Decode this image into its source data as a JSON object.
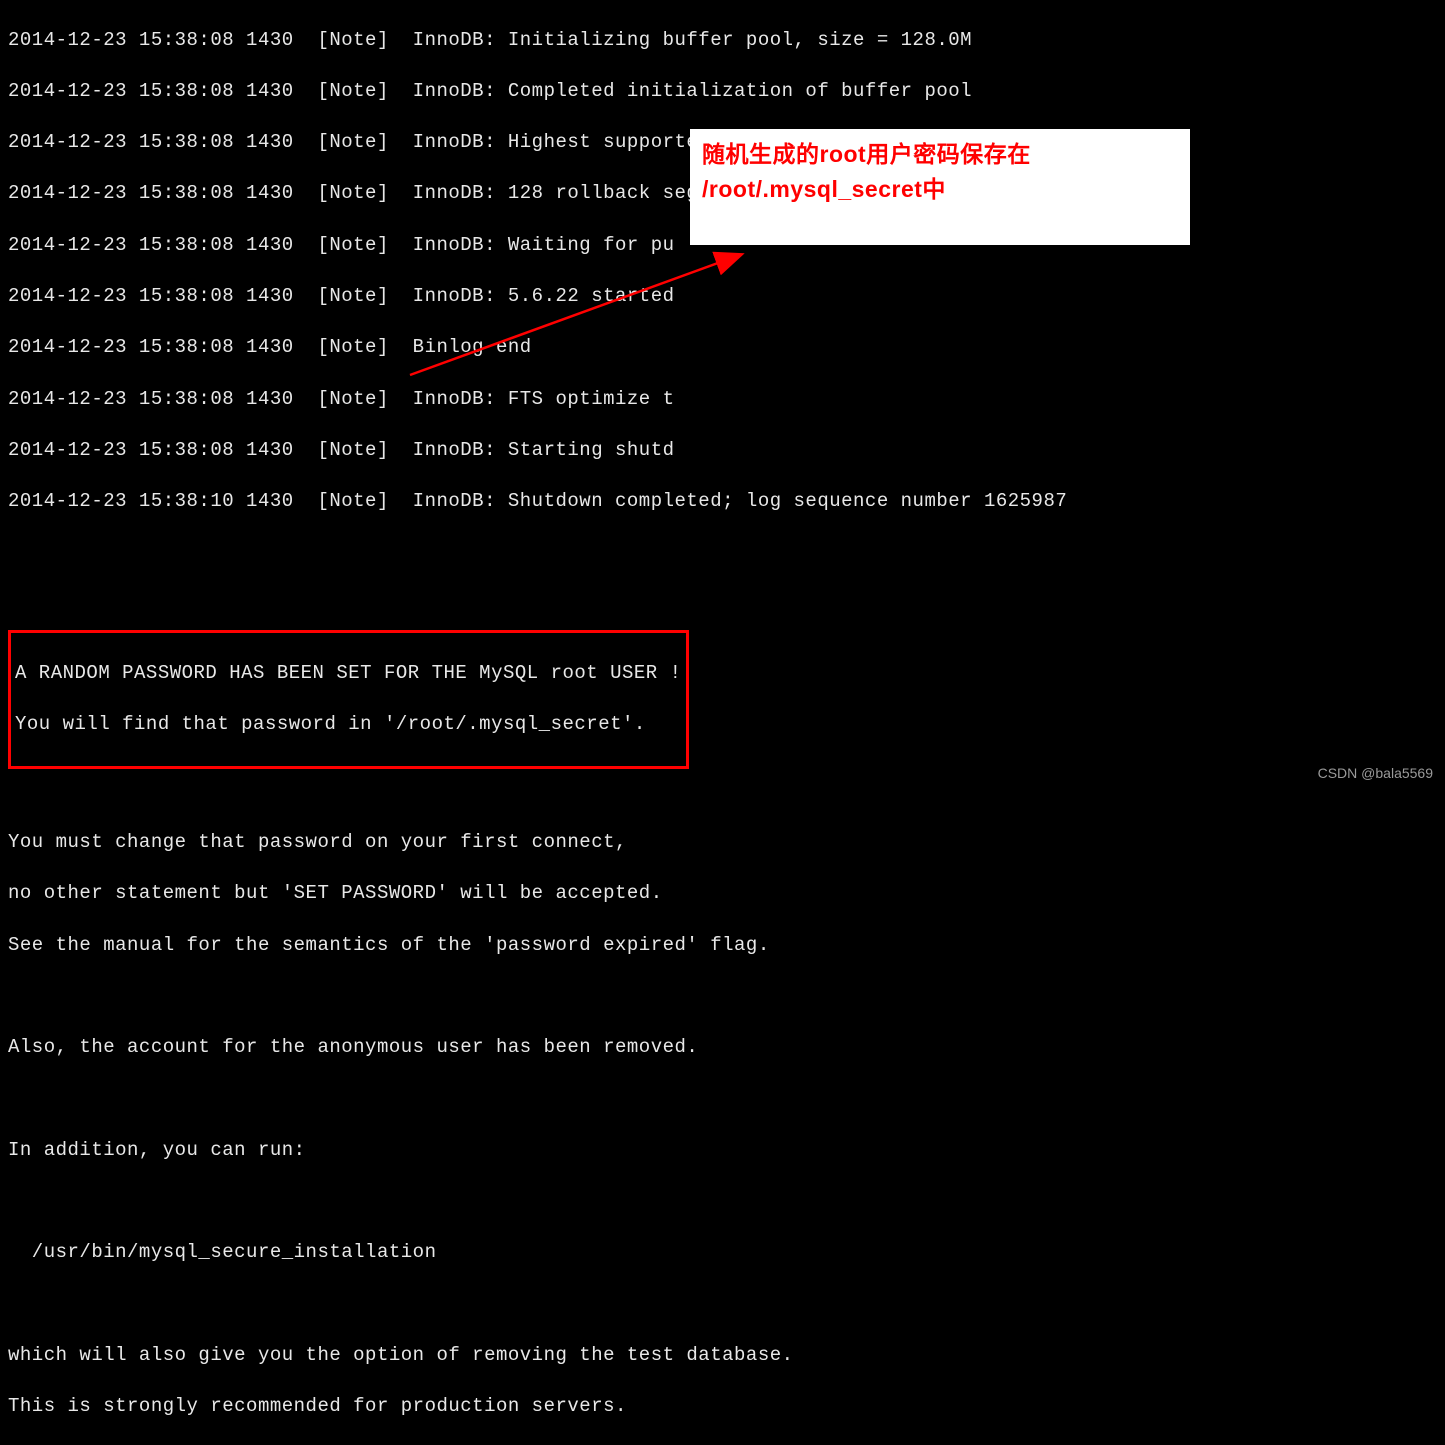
{
  "log_lines": [
    "2014-12-23 15:38:08 1430  [Note]  InnoDB: Initializing buffer pool, size = 128.0M",
    "2014-12-23 15:38:08 1430  [Note]  InnoDB: Completed initialization of buffer pool",
    "2014-12-23 15:38:08 1430  [Note]  InnoDB: Highest supported file format is Barracuda.",
    "2014-12-23 15:38:08 1430  [Note]  InnoDB: 128 rollback segment(s) are active.",
    "2014-12-23 15:38:08 1430  [Note]  InnoDB: Waiting for pu",
    "2014-12-23 15:38:08 1430  [Note]  InnoDB: 5.6.22 started",
    "2014-12-23 15:38:08 1430  [Note]  Binlog end",
    "2014-12-23 15:38:08 1430  [Note]  InnoDB: FTS optimize t",
    "2014-12-23 15:38:08 1430  [Note]  InnoDB: Starting shutd",
    "2014-12-23 15:38:10 1430  [Note]  InnoDB: Shutdown completed; log sequence number 1625987"
  ],
  "boxed": {
    "line1": "A RANDOM PASSWORD HAS BEEN SET FOR THE MySQL root USER !",
    "line2": "You will find that password in '/root/.mysql_secret'."
  },
  "body_lines": [
    "You must change that password on your first connect,",
    "no other statement but 'SET PASSWORD' will be accepted.",
    "See the manual for the semantics of the 'password expired' flag.",
    "",
    "Also, the account for the anonymous user has been removed.",
    "",
    "In addition, you can run:",
    "",
    "  /usr/bin/mysql_secure_installation",
    "",
    "which will also give you the option of removing the test database.",
    "This is strongly recommended for production servers."
  ],
  "callout": {
    "line1": "随机生成的root用户密码保存在",
    "line2": "/root/.mysql_secret中"
  },
  "watermark": "CSDN @bala5569"
}
